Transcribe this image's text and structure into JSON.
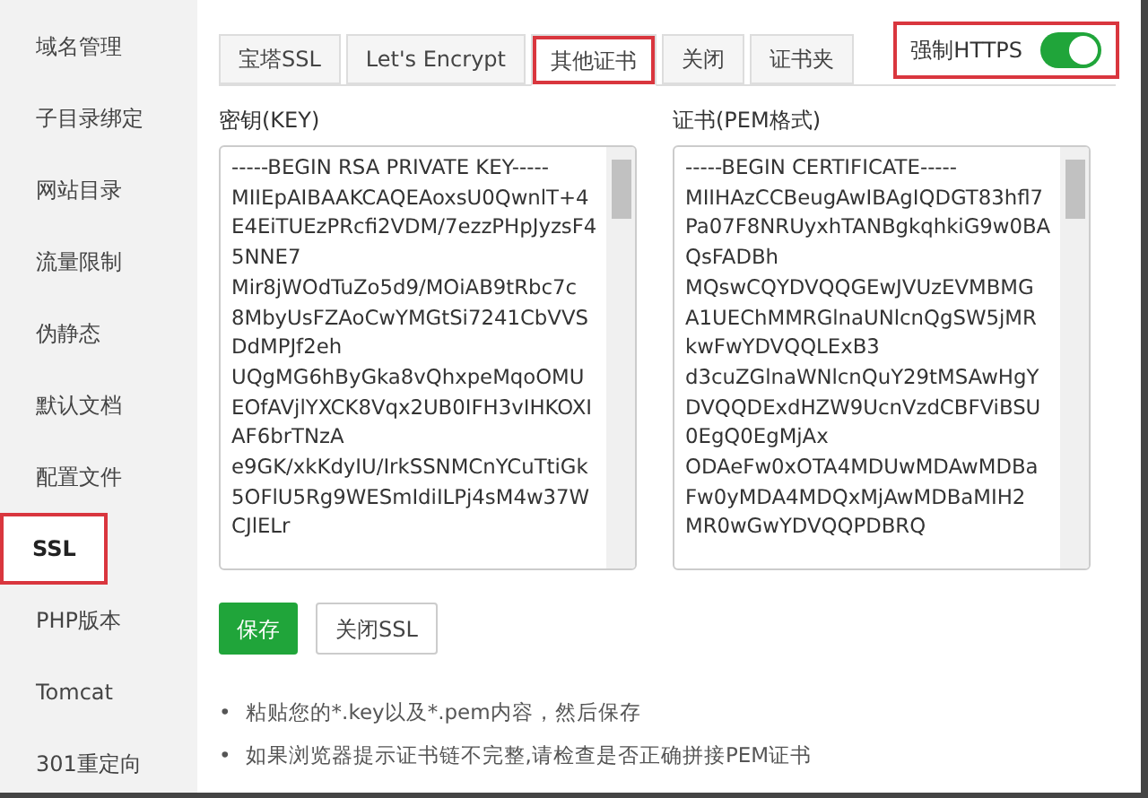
{
  "sidebar": {
    "items": [
      {
        "label": "域名管理",
        "selected": false,
        "highlighted": false
      },
      {
        "label": "子目录绑定",
        "selected": false,
        "highlighted": false
      },
      {
        "label": "网站目录",
        "selected": false,
        "highlighted": false
      },
      {
        "label": "流量限制",
        "selected": false,
        "highlighted": false
      },
      {
        "label": "伪静态",
        "selected": false,
        "highlighted": false
      },
      {
        "label": "默认文档",
        "selected": false,
        "highlighted": false
      },
      {
        "label": "配置文件",
        "selected": false,
        "highlighted": false
      },
      {
        "label": "SSL",
        "selected": true,
        "highlighted": true
      },
      {
        "label": "PHP版本",
        "selected": false,
        "highlighted": false
      },
      {
        "label": "Tomcat",
        "selected": false,
        "highlighted": false
      },
      {
        "label": "301重定向",
        "selected": false,
        "highlighted": false
      }
    ]
  },
  "tabs": [
    {
      "label": "宝塔SSL",
      "selected": false,
      "highlighted": false
    },
    {
      "label": "Let's Encrypt",
      "selected": false,
      "highlighted": false
    },
    {
      "label": "其他证书",
      "selected": true,
      "highlighted": true
    },
    {
      "label": "关闭",
      "selected": false,
      "highlighted": false
    },
    {
      "label": "证书夹",
      "selected": false,
      "highlighted": false
    }
  ],
  "force_https": {
    "label": "强制HTTPS",
    "on": true,
    "highlighted": true
  },
  "key_field": {
    "label": "密钥(KEY)",
    "lines": [
      "-----BEGIN RSA PRIVATE KEY-----",
      "MIIEpAIBAAKCAQEAoxsU0QwnlT+4",
      "E4EiTUEzPRcfi2VDM/7ezzPHpJyzsF4",
      "5NNE7",
      "Mir8jWOdTuZo5d9/MOiAB9tRbc7c",
      "8MbyUsFZAoCwYMGtSi7241CbVVS",
      "DdMPJf2eh",
      "UQgMG6hByGka8vQhxpeMqoOMU",
      "EOfAVjlYXCK8Vqx2UB0IFH3vIHKOXI",
      "AF6brTNzA",
      "e9GK/xkKdyIU/IrkSSNMCnYCuTtiGk",
      "5OFlU5Rg9WESmIdiILPj4sM4w37W",
      "CJlELr"
    ]
  },
  "cert_field": {
    "label": "证书(PEM格式)",
    "lines": [
      "-----BEGIN CERTIFICATE-----",
      "MIIHAzCCBeugAwIBAgIQDGT83hfl7",
      "Pa07F8NRUyxhTANBgkqhkiG9w0BA",
      "QsFADBh",
      "MQswCQYDVQQGEwJVUzEVMBMG",
      "A1UEChMMRGlnaUNlcnQgSW5jMR",
      "kwFwYDVQQLExB3",
      "d3cuZGlnaWNlcnQuY29tMSAwHgY",
      "DVQQDExdHZW9UcnVzdCBFViBSU",
      "0EgQ0EgMjAx",
      "ODAeFw0xOTA4MDUwMDAwMDBa",
      "Fw0yMDA4MDQxMjAwMDBaMIH2",
      "MR0wGwYDVQQPDBRQ"
    ]
  },
  "buttons": [
    {
      "label": "保存",
      "kind": "primary"
    },
    {
      "label": "关闭SSL",
      "kind": "secondary"
    }
  ],
  "notes": [
    {
      "bullet": "•",
      "text": "粘贴您的*.key以及*.pem内容，然后保存"
    },
    {
      "bullet": "•",
      "text": "如果浏览器提示证书链不完整,请检查是否正确拼接PEM证书"
    }
  ]
}
